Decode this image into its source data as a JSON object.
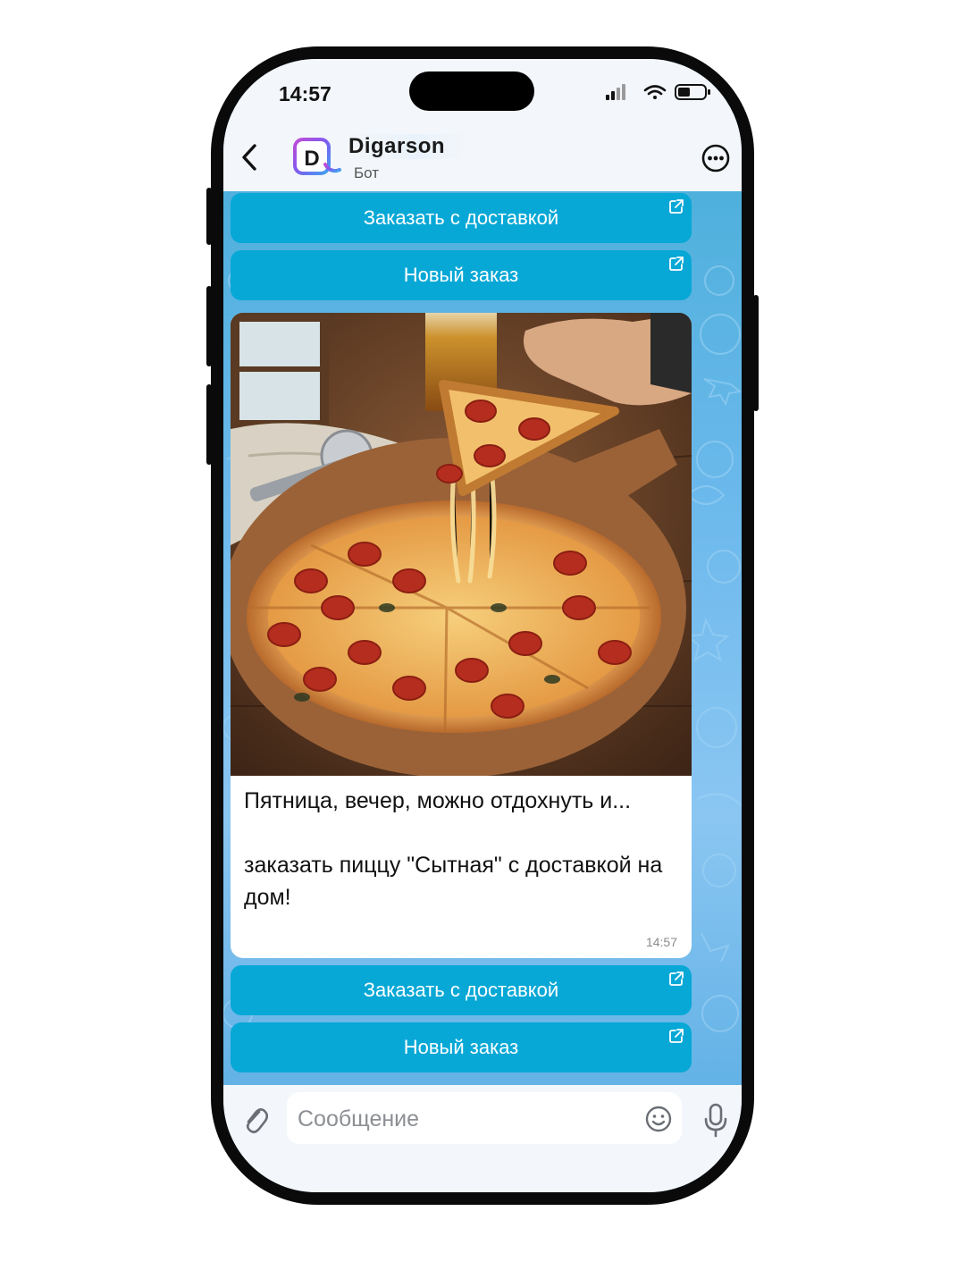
{
  "status_bar": {
    "time": "14:57"
  },
  "header": {
    "bot_name": "Digarson",
    "bot_status": "Бот",
    "avatar_letter": "D"
  },
  "top_keyboard": [
    {
      "label": "Заказать с доставкой"
    },
    {
      "label": "Новый заказ"
    }
  ],
  "message": {
    "line1": "Пятница, вечер, можно отдохнуть и...",
    "line2": "заказать пиццу \"Сытная\" с доставкой на дом!",
    "time": "14:57"
  },
  "bottom_keyboard": [
    {
      "label": "Заказать с доставкой"
    },
    {
      "label": "Новый заказ"
    }
  ],
  "input": {
    "placeholder": "Сообщение"
  },
  "colors": {
    "keyboard_button": "#07a8d6",
    "chat_background": "#6cb9ec",
    "accent_purple": "#8b5cf6"
  },
  "icons": [
    "back-arrow-icon",
    "more-icon",
    "external-link-icon",
    "paperclip-icon",
    "emoji-icon",
    "microphone-icon",
    "signal-icon",
    "wifi-icon",
    "battery-icon"
  ]
}
